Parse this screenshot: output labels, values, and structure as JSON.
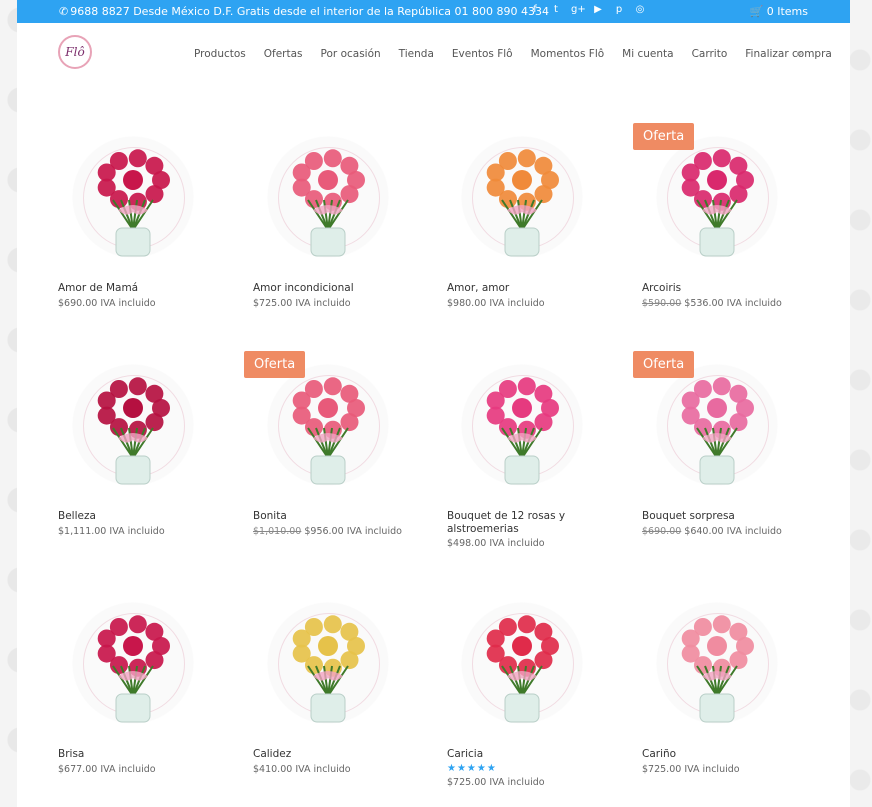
{
  "topbar": {
    "phone": "9688 8827 Desde México D.F. Gratis desde el interior de la República 01 800 890 4334",
    "social": [
      "f",
      "t",
      "g+",
      "▶",
      "p",
      "◎"
    ],
    "cart_label": "0 Items"
  },
  "nav": {
    "logo": "Flô",
    "items": [
      "Productos",
      "Ofertas",
      "Por ocasión",
      "Tienda",
      "Eventos Flô",
      "Momentos Flô",
      "Mi cuenta",
      "Carrito",
      "Finalizar compra"
    ]
  },
  "colors": {
    "accent": "#2ea3f2",
    "badge": "#ef8b63"
  },
  "badge_label": "Oferta",
  "products": [
    {
      "title": "Amor de Mamá",
      "old": "",
      "price": "$690.00",
      "tax": "IVA incluido",
      "sale": false
    },
    {
      "title": "Amor incondicional",
      "old": "",
      "price": "$725.00",
      "tax": "IVA incluido",
      "sale": false
    },
    {
      "title": "Amor, amor",
      "old": "",
      "price": "$980.00",
      "tax": "IVA incluido",
      "sale": false
    },
    {
      "title": "Arcoiris",
      "old": "$590.00",
      "price": "$536.00",
      "tax": "IVA incluido",
      "sale": true
    },
    {
      "title": "Belleza",
      "old": "",
      "price": "$1,111.00",
      "tax": "IVA incluido",
      "sale": false
    },
    {
      "title": "Bonita",
      "old": "$1,010.00",
      "price": "$956.00",
      "tax": "IVA incluido",
      "sale": true
    },
    {
      "title": "Bouquet de 12 rosas y alstroemerias",
      "old": "",
      "price": "$498.00",
      "tax": "IVA incluido",
      "sale": false
    },
    {
      "title": "Bouquet sorpresa",
      "old": "$690.00",
      "price": "$640.00",
      "tax": "IVA incluido",
      "sale": true
    },
    {
      "title": "Brisa",
      "old": "",
      "price": "$677.00",
      "tax": "IVA incluido",
      "sale": false
    },
    {
      "title": "Calidez",
      "old": "",
      "price": "$410.00",
      "tax": "IVA incluido",
      "sale": false
    },
    {
      "title": "Caricia",
      "old": "",
      "price": "$725.00",
      "tax": "IVA incluido",
      "sale": false,
      "stars": "★★★★★"
    },
    {
      "title": "Cariño",
      "old": "",
      "price": "$725.00",
      "tax": "IVA incluido",
      "sale": false
    }
  ]
}
